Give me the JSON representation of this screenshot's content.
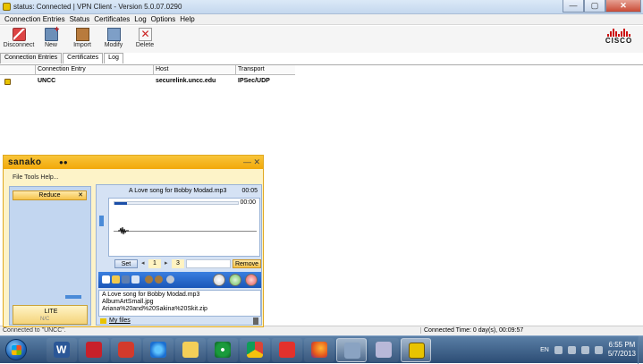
{
  "window": {
    "title": "status: Connected | VPN Client - Version 5.0.07.0290",
    "min_glyph": "—",
    "max_glyph": "▢",
    "close_glyph": "✕"
  },
  "menu": [
    "Connection Entries",
    "Status",
    "Certificates",
    "Log",
    "Options",
    "Help"
  ],
  "toolbar": {
    "disconnect": "Disconnect",
    "new": "New",
    "import": "Import",
    "modify": "Modify",
    "delete": "Delete"
  },
  "brand": {
    "logo_text": "CISCO"
  },
  "tabs": [
    "Connection Entries",
    "Certificates",
    "Log"
  ],
  "table": {
    "headers": [
      "Connection Entry",
      "Host",
      "Transport"
    ],
    "rows": [
      {
        "entry": "UNCC",
        "host": "securelink.uncc.edu",
        "transport": "IPSec/UDP"
      }
    ]
  },
  "status": {
    "left": "Connected to \"UNCC\".",
    "right": "Connected Time: 0 day(s), 00:09:57"
  },
  "sanako": {
    "logo": "sanako",
    "logo_mark": "●●",
    "win_glyphs": "— ✕",
    "menu": "File  Tools  Help...",
    "reduce_label": "Reduce",
    "reduce_close": "✕",
    "lite_label": "LITE",
    "lite_sub": "N/C",
    "track": "A Love song for Bobby Modad.mp3",
    "time1": "00:05",
    "time2": "00:00",
    "progress": 0.1,
    "set_label": "Set",
    "left_arrow": "◂",
    "right_arrow": "▸",
    "num1": "1",
    "num2": "3",
    "remove_label": "Remove",
    "files": [
      "A Love song for Bobby Modad.mp3",
      "AlbumArtSmall.jpg",
      "Ariana%20and%20Sakina%20Skit.zip"
    ],
    "myfiles_label": "My files"
  },
  "taskbar": {
    "lang": "EN",
    "time": "6:55 PM",
    "date": "5/7/2013"
  }
}
